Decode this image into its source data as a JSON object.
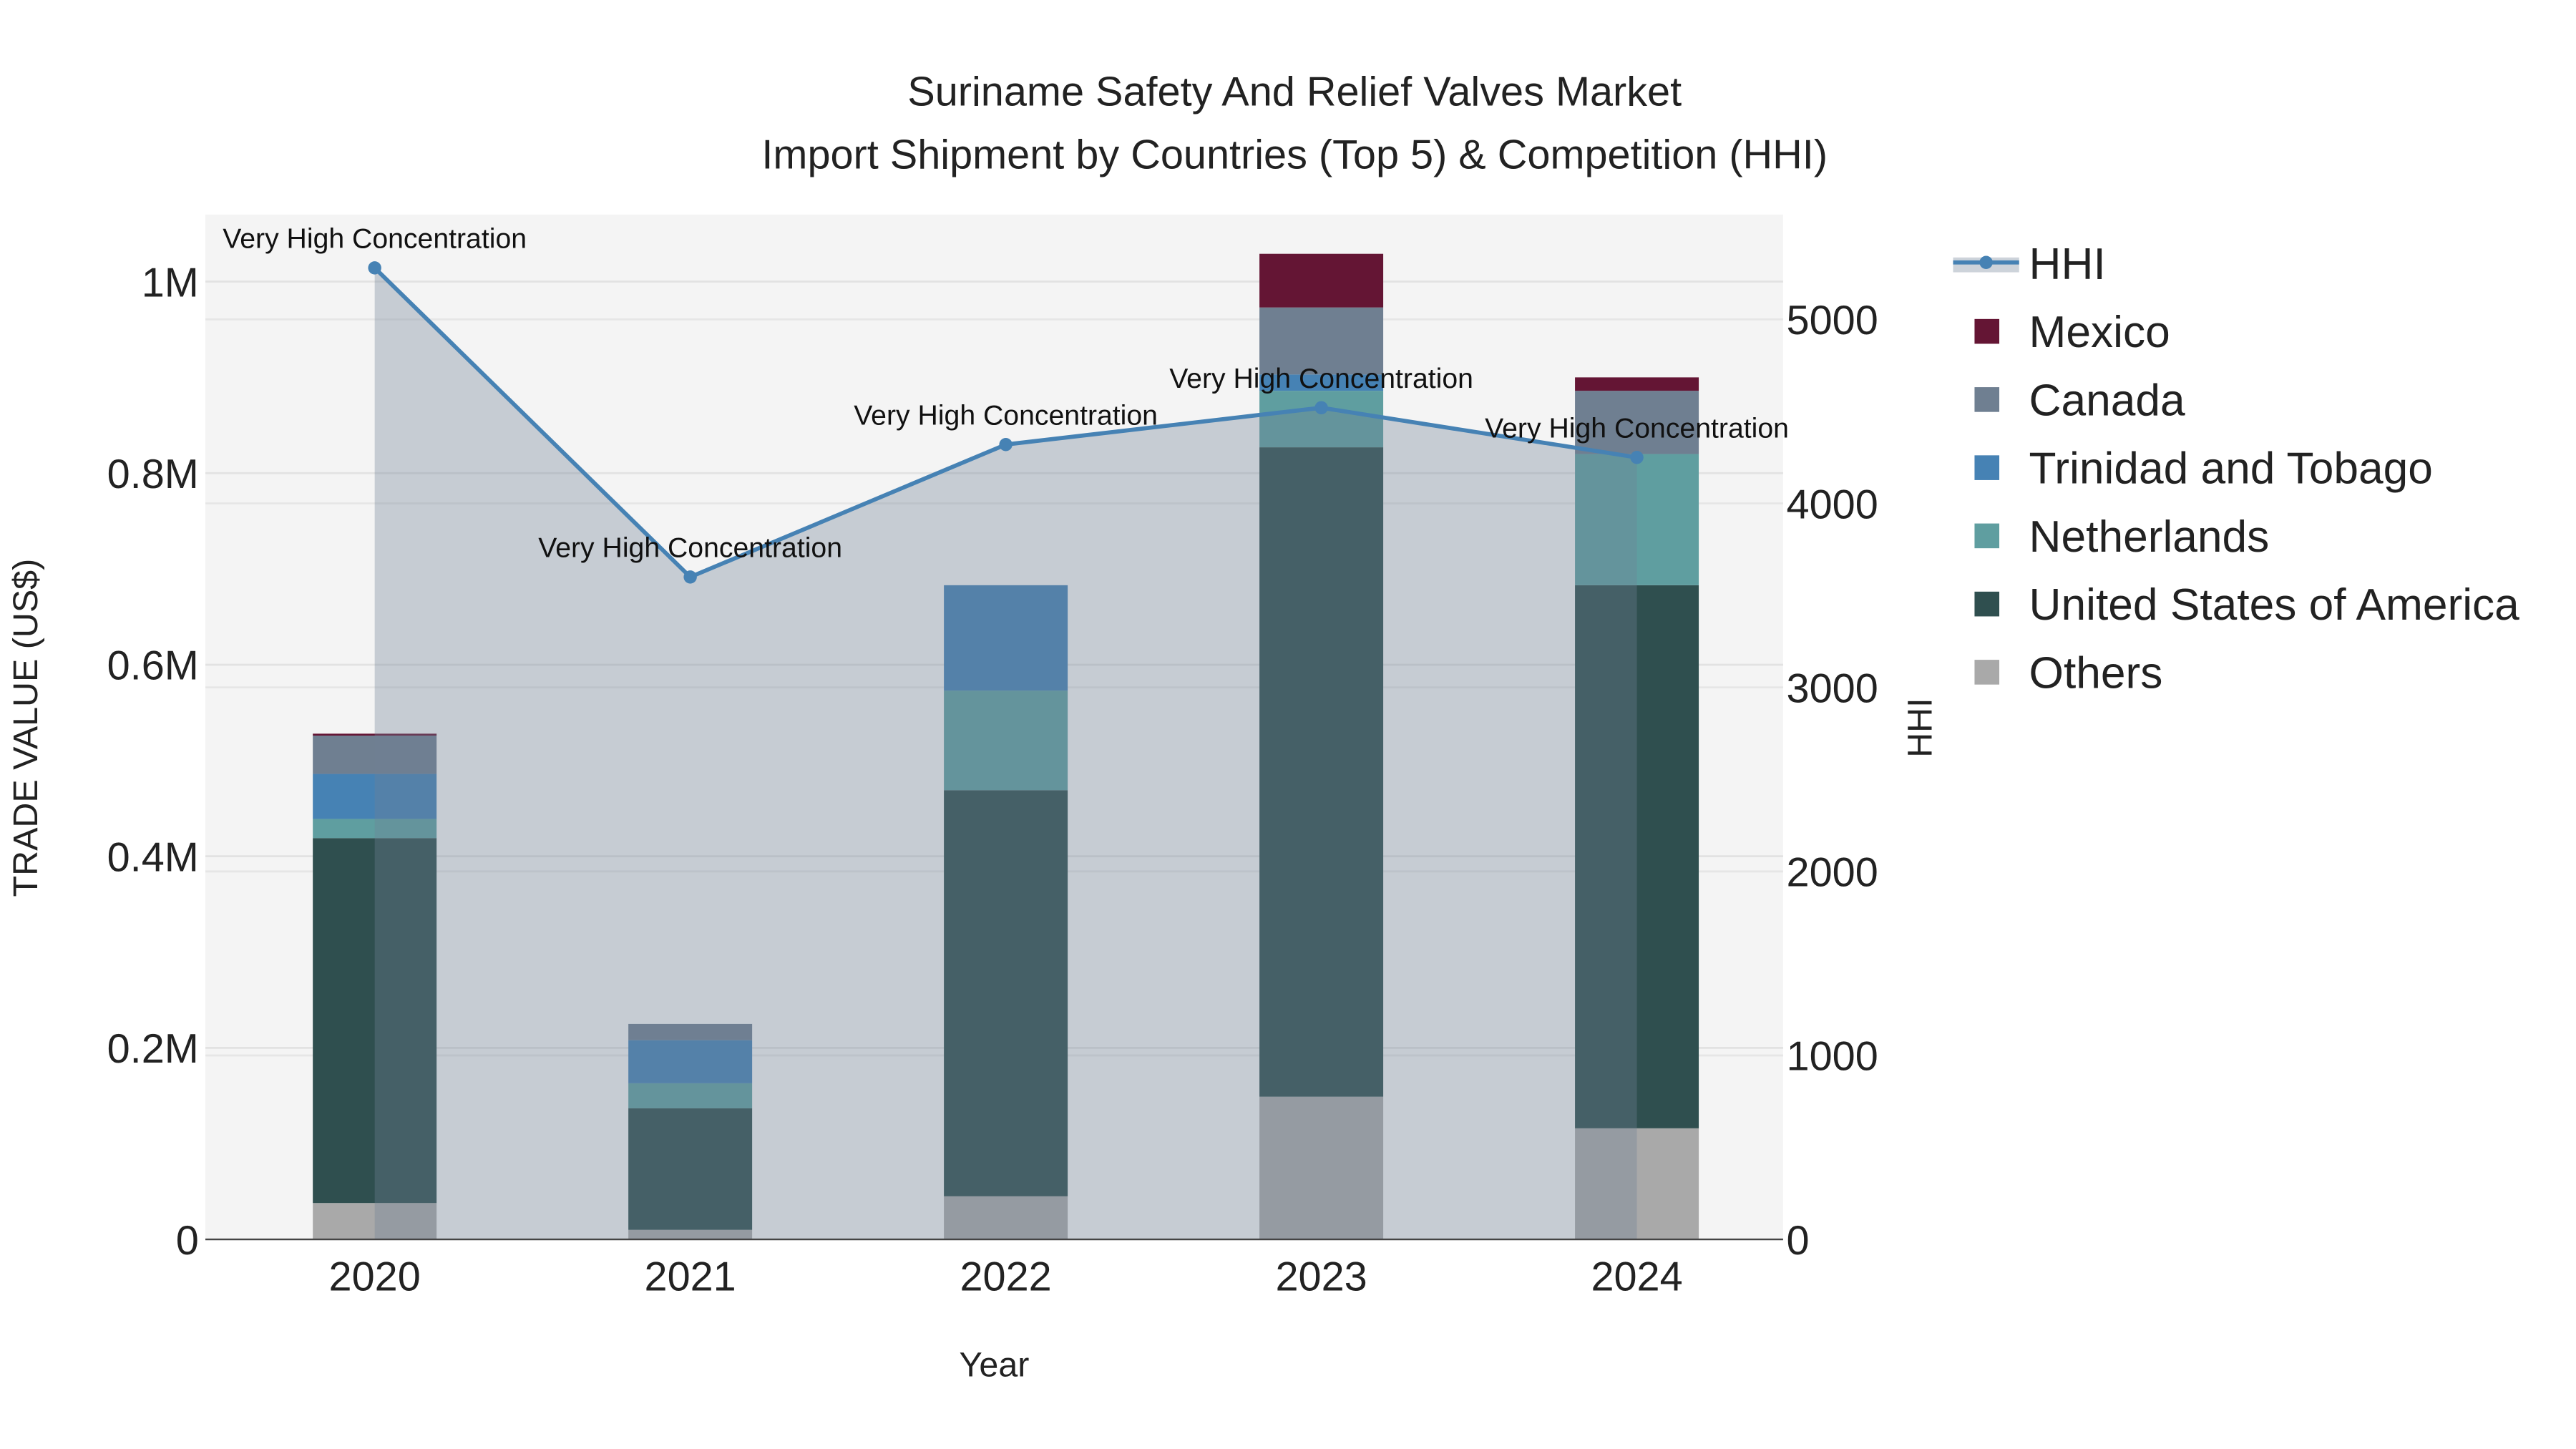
{
  "chart_data": {
    "type": "bar",
    "title": "Suriname Safety And Relief Valves Market",
    "subtitle": "Import Shipment by Countries (Top 5) & Competition (HHI)",
    "xlabel": "Year",
    "ylabel": "TRADE VALUE (US$)",
    "y2label": "HHI",
    "categories": [
      "2020",
      "2021",
      "2022",
      "2023",
      "2024"
    ],
    "ylim": [
      0,
      1070000
    ],
    "y2lim": [
      0,
      5570
    ],
    "yticks": [
      0,
      200000,
      400000,
      600000,
      800000,
      1000000
    ],
    "ytick_labels": [
      "0",
      "0.2M",
      "0.4M",
      "0.6M",
      "0.8M",
      "1M"
    ],
    "y2ticks": [
      0,
      1000,
      2000,
      3000,
      4000,
      5000
    ],
    "y2tick_labels": [
      "0",
      "1000",
      "2000",
      "3000",
      "4000",
      "5000"
    ],
    "grid": true,
    "legend_position": "right",
    "series": [
      {
        "name": "Others",
        "color": "#a9a9a9",
        "values": [
          38000,
          10000,
          45000,
          149000,
          116000
        ]
      },
      {
        "name": "United States of America",
        "color": "#2f4f4f",
        "values": [
          381000,
          127000,
          424000,
          678000,
          567000
        ]
      },
      {
        "name": "Netherlands",
        "color": "#5f9ea0",
        "values": [
          20000,
          26000,
          104000,
          59000,
          137000
        ]
      },
      {
        "name": "Trinidad and Tobago",
        "color": "#4682b4",
        "values": [
          47000,
          45000,
          110000,
          17000,
          0
        ]
      },
      {
        "name": "Canada",
        "color": "#6f7f91",
        "values": [
          40000,
          17000,
          0,
          70000,
          66000
        ]
      },
      {
        "name": "Mexico",
        "color": "#641534",
        "values": [
          2000,
          0,
          0,
          56000,
          14000
        ]
      }
    ],
    "hhi": {
      "name": "HHI",
      "color": "#4682b4",
      "values": [
        5280,
        3600,
        4320,
        4520,
        4250
      ],
      "annotations": [
        "Very High Concentration",
        "Very High Concentration",
        "Very High Concentration",
        "Very High Concentration",
        "Very High Concentration"
      ]
    },
    "legend": [
      "HHI",
      "Mexico",
      "Canada",
      "Trinidad and Tobago",
      "Netherlands",
      "United States of America",
      "Others"
    ]
  }
}
